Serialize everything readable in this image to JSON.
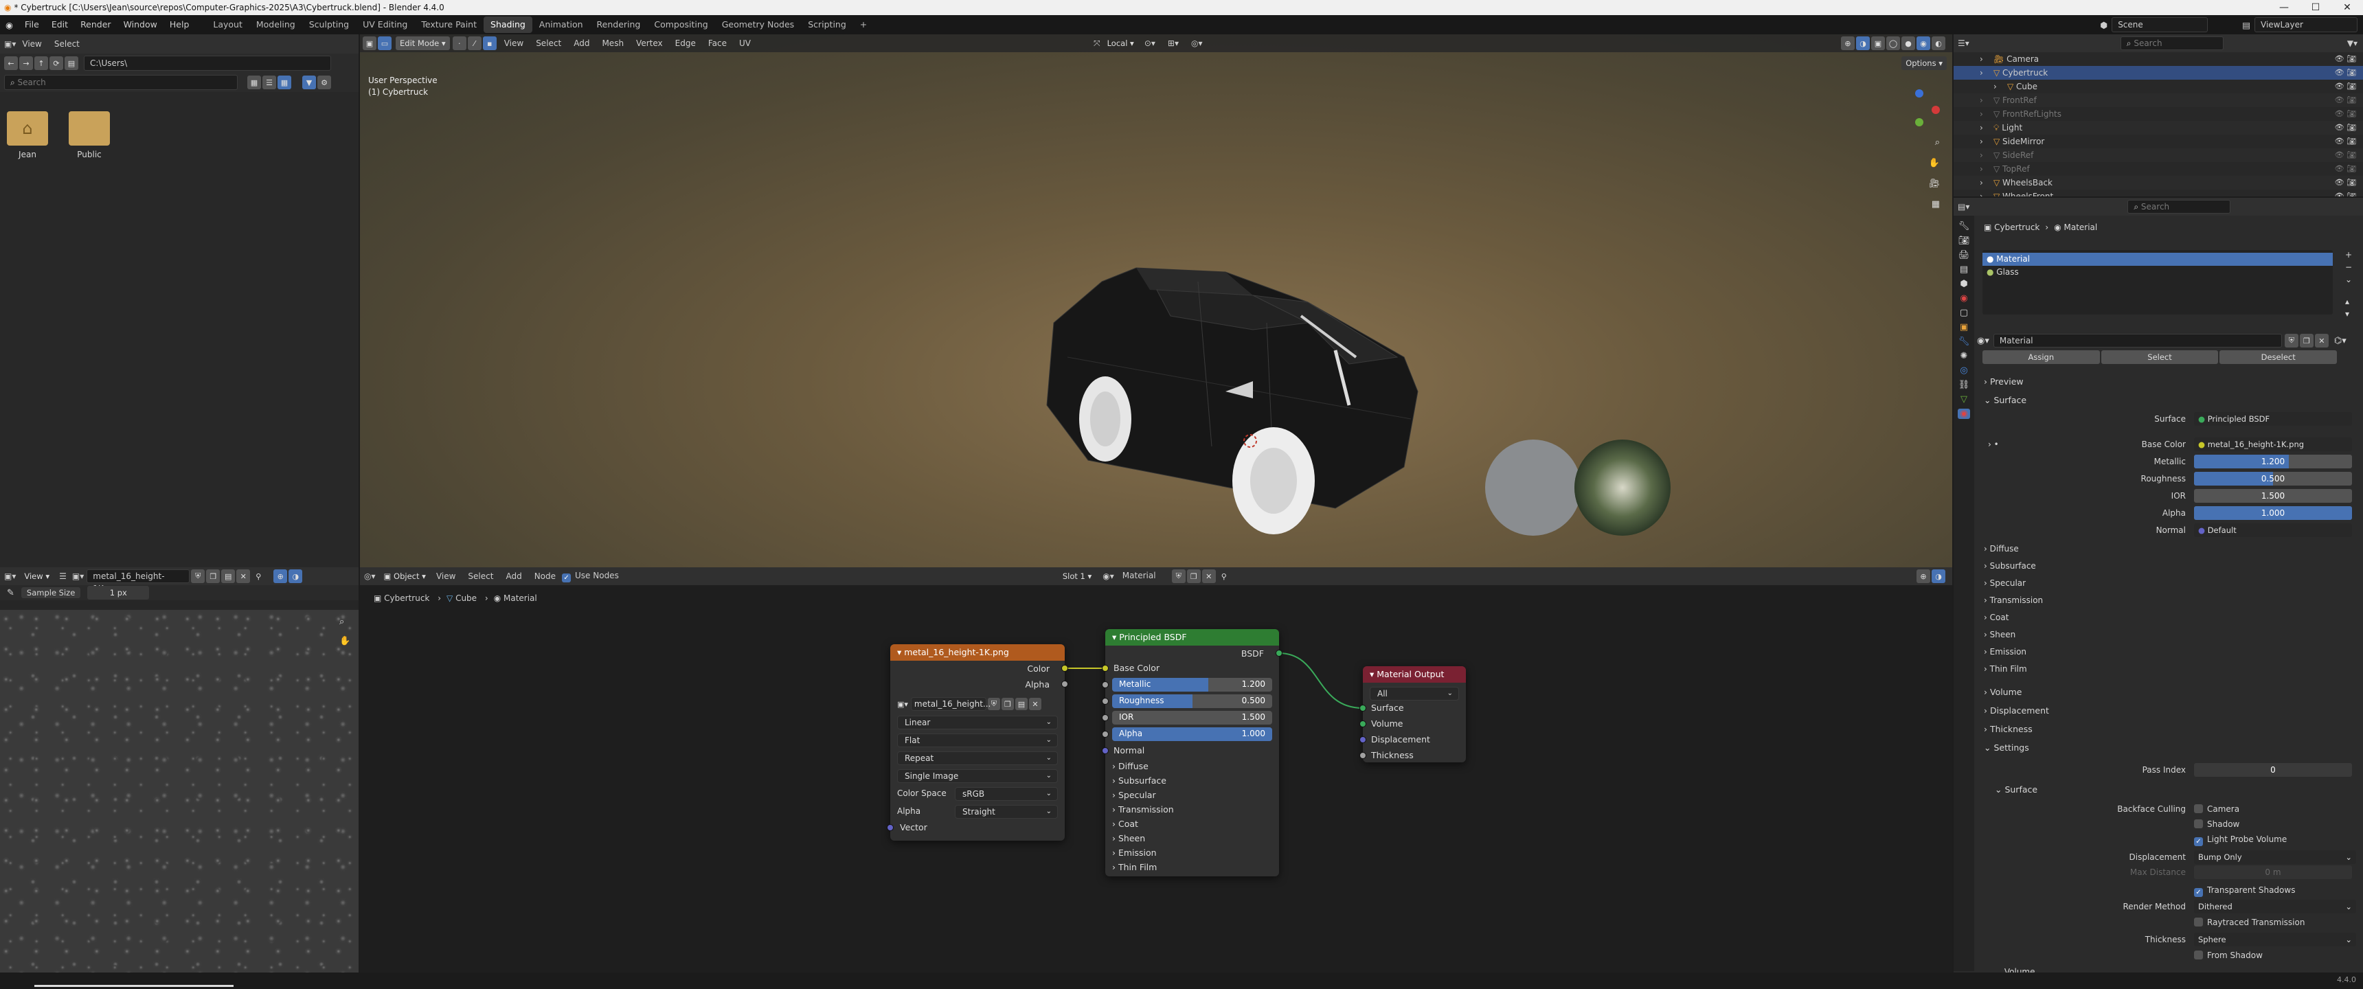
{
  "window": {
    "title": "* Cybertruck [C:\\Users\\Jean\\source\\repos\\Computer-Graphics-2025\\A3\\Cybertruck.blend] - Blender 4.4.0"
  },
  "menu": [
    "File",
    "Edit",
    "Render",
    "Window",
    "Help"
  ],
  "workspaces": [
    "Layout",
    "Modeling",
    "Sculpting",
    "UV Editing",
    "Texture Paint",
    "Shading",
    "Animation",
    "Rendering",
    "Compositing",
    "Geometry Nodes",
    "Scripting"
  ],
  "active_workspace": "Shading",
  "scene": {
    "scene_name": "Scene",
    "view_layer": "ViewLayer"
  },
  "file_browser": {
    "menu": [
      "View",
      "Select"
    ],
    "path": "C:\\Users\\",
    "search_placeholder": "Search",
    "folders": [
      "Jean",
      "Public"
    ]
  },
  "viewport": {
    "mode": "Edit Mode",
    "menus": [
      "View",
      "Select",
      "Add",
      "Mesh",
      "Vertex",
      "Edge",
      "Face",
      "UV"
    ],
    "orientation": "Local",
    "perspective_label": "User Perspective",
    "object_label": "(1) Cybertruck",
    "options_label": "Options"
  },
  "image_editor": {
    "view_menu": "View",
    "image_name": "metal_16_height-1K.png",
    "sample_size_label": "Sample Size",
    "sample_size_value": "1 px"
  },
  "node_editor": {
    "object_mode": "Object",
    "menus": [
      "View",
      "Select",
      "Add",
      "Node"
    ],
    "use_nodes_label": "Use Nodes",
    "slot": "Slot 1",
    "material": "Material",
    "breadcrumb": [
      "Cybertruck",
      "Cube",
      "Material"
    ],
    "image_node": {
      "title": "metal_16_height-1K.png",
      "outputs": [
        "Color",
        "Alpha"
      ],
      "image_field": "metal_16_height...",
      "interpolation": "Linear",
      "projection": "Flat",
      "extension": "Repeat",
      "source": "Single Image",
      "color_space_label": "Color Space",
      "color_space": "sRGB",
      "alpha_label": "Alpha",
      "alpha_mode": "Straight",
      "vector_label": "Vector"
    },
    "bsdf_node": {
      "title": "Principled BSDF",
      "output": "BSDF",
      "base_color": "Base Color",
      "metallic": {
        "label": "Metallic",
        "value": "1.200",
        "fill": 0.6
      },
      "roughness": {
        "label": "Roughness",
        "value": "0.500",
        "fill": 0.5
      },
      "ior": {
        "label": "IOR",
        "value": "1.500",
        "fill": 0.0
      },
      "alpha": {
        "label": "Alpha",
        "value": "1.000",
        "fill": 1.0
      },
      "normal": "Normal",
      "panels": [
        "Diffuse",
        "Subsurface",
        "Specular",
        "Transmission",
        "Coat",
        "Sheen",
        "Emission",
        "Thin Film"
      ]
    },
    "output_node": {
      "title": "Material Output",
      "target": "All",
      "inputs": [
        "Surface",
        "Volume",
        "Displacement",
        "Thickness"
      ]
    }
  },
  "outliner": {
    "search_placeholder": "Search",
    "items": [
      {
        "name": "Camera",
        "selected": false,
        "dim": false
      },
      {
        "name": "Cybertruck",
        "selected": true,
        "dim": false
      },
      {
        "name": "Cube",
        "selected": false,
        "dim": false,
        "child": true
      },
      {
        "name": "FrontRef",
        "selected": false,
        "dim": true
      },
      {
        "name": "FrontRefLights",
        "selected": false,
        "dim": true
      },
      {
        "name": "Light",
        "selected": false,
        "dim": false
      },
      {
        "name": "SideMirror",
        "selected": false,
        "dim": false
      },
      {
        "name": "SideRef",
        "selected": false,
        "dim": true
      },
      {
        "name": "TopRef",
        "selected": false,
        "dim": true
      },
      {
        "name": "WheelsBack",
        "selected": false,
        "dim": false
      },
      {
        "name": "WheelsFront",
        "selected": false,
        "dim": false
      }
    ]
  },
  "properties": {
    "search_placeholder": "Search",
    "breadcrumb": [
      "Cybertruck",
      "Material"
    ],
    "slots": [
      "Material",
      "Glass"
    ],
    "material_name": "Material",
    "assign": "Assign",
    "select": "Select",
    "deselect": "Deselect",
    "preview": "Preview",
    "surface_section": "Surface",
    "surface_label": "Surface",
    "surface_value": "Principled BSDF",
    "base_color_label": "Base Color",
    "base_color_value": "metal_16_height-1K.png",
    "metallic": {
      "label": "Metallic",
      "value": "1.200",
      "fill": 0.6
    },
    "roughness": {
      "label": "Roughness",
      "value": "0.500",
      "fill": 0.5
    },
    "ior": {
      "label": "IOR",
      "value": "1.500",
      "fill": 0.0
    },
    "alpha": {
      "label": "Alpha",
      "value": "1.000",
      "fill": 1.0
    },
    "normal_label": "Normal",
    "normal_value": "Default",
    "sub_panels": [
      "Diffuse",
      "Subsurface",
      "Specular",
      "Transmission",
      "Coat",
      "Sheen",
      "Emission",
      "Thin Film"
    ],
    "other_sections": [
      "Volume",
      "Displacement",
      "Thickness",
      "Settings"
    ],
    "pass_index_label": "Pass Index",
    "pass_index_value": "0",
    "settings_surface": "Surface",
    "backface_culling_label": "Backface Culling",
    "camera": "Camera",
    "shadow": "Shadow",
    "light_probe_volume": "Light Probe Volume",
    "displacement_label": "Displacement",
    "displacement_value": "Bump Only",
    "max_distance_label": "Max Distance",
    "max_distance_value": "0 m",
    "transparent_shadows": "Transparent Shadows",
    "render_method_label": "Render Method",
    "render_method_value": "Dithered",
    "raytraced_transmission": "Raytraced Transmission",
    "thickness_label": "Thickness",
    "thickness_value": "Sphere",
    "from_shadow": "From Shadow",
    "volume_tail": "Volume"
  },
  "status": {
    "version": "4.4.0"
  },
  "colors": {
    "accent": "#4772b3",
    "image_node": "#b05a1e",
    "bsdf_node": "#2e7d32",
    "output_node": "#7a2132",
    "link": "#c7c729"
  }
}
